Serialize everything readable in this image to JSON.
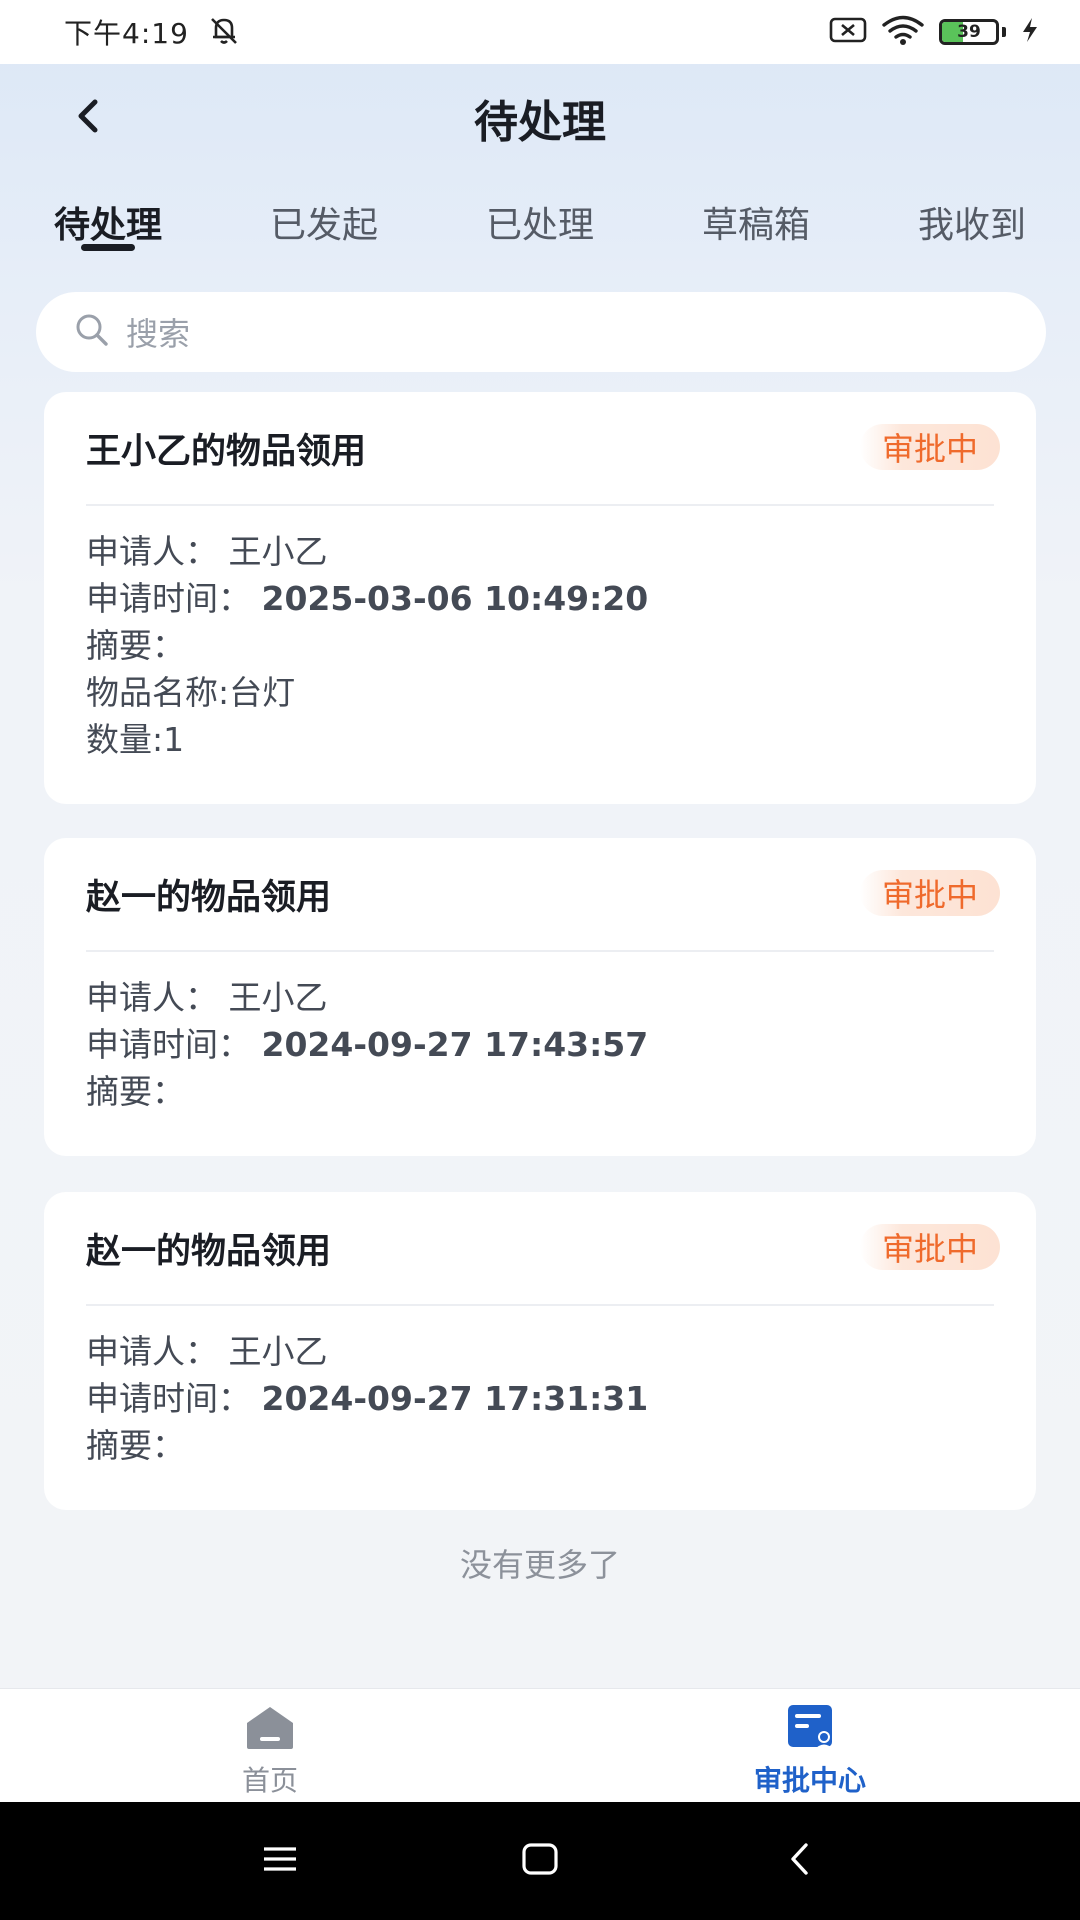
{
  "status_bar": {
    "time": "下午4:19",
    "battery": "39",
    "battery_level": 0.39
  },
  "header": {
    "title": "待处理",
    "back_icon": "chevron-left-icon"
  },
  "tabs": [
    {
      "label": "待处理",
      "active": true
    },
    {
      "label": "已发起",
      "active": false
    },
    {
      "label": "已处理",
      "active": false
    },
    {
      "label": "草稿箱",
      "active": false
    },
    {
      "label": "我收到",
      "active": false
    }
  ],
  "search": {
    "placeholder": "搜索",
    "icon": "search-icon"
  },
  "cards": [
    {
      "title": "王小乙的物品领用",
      "status": "审批中",
      "applicant_label": "申请人：",
      "applicant": "王小乙",
      "time_label": "申请时间：",
      "time": "2025-03-06 10:49:20",
      "summary_label": "摘要：",
      "extra": [
        "物品名称:台灯",
        "数量:1"
      ]
    },
    {
      "title": "赵一的物品领用",
      "status": "审批中",
      "applicant_label": "申请人：",
      "applicant": "王小乙",
      "time_label": "申请时间：",
      "time": "2024-09-27 17:43:57",
      "summary_label": "摘要："
    },
    {
      "title": "赵一的物品领用",
      "status": "审批中",
      "applicant_label": "申请人：",
      "applicant": "王小乙",
      "time_label": "申请时间：",
      "time": "2024-09-27 17:31:31",
      "summary_label": "摘要："
    }
  ],
  "list_footer": "没有更多了",
  "bottom_nav": [
    {
      "label": "首页",
      "icon": "home-icon",
      "active": false
    },
    {
      "label": "审批中心",
      "icon": "approval-center-icon",
      "active": true
    }
  ],
  "colors": {
    "accent": "#1f61c9",
    "badge_text": "#ef6a2c",
    "badge_bg": "#fde2d3"
  }
}
